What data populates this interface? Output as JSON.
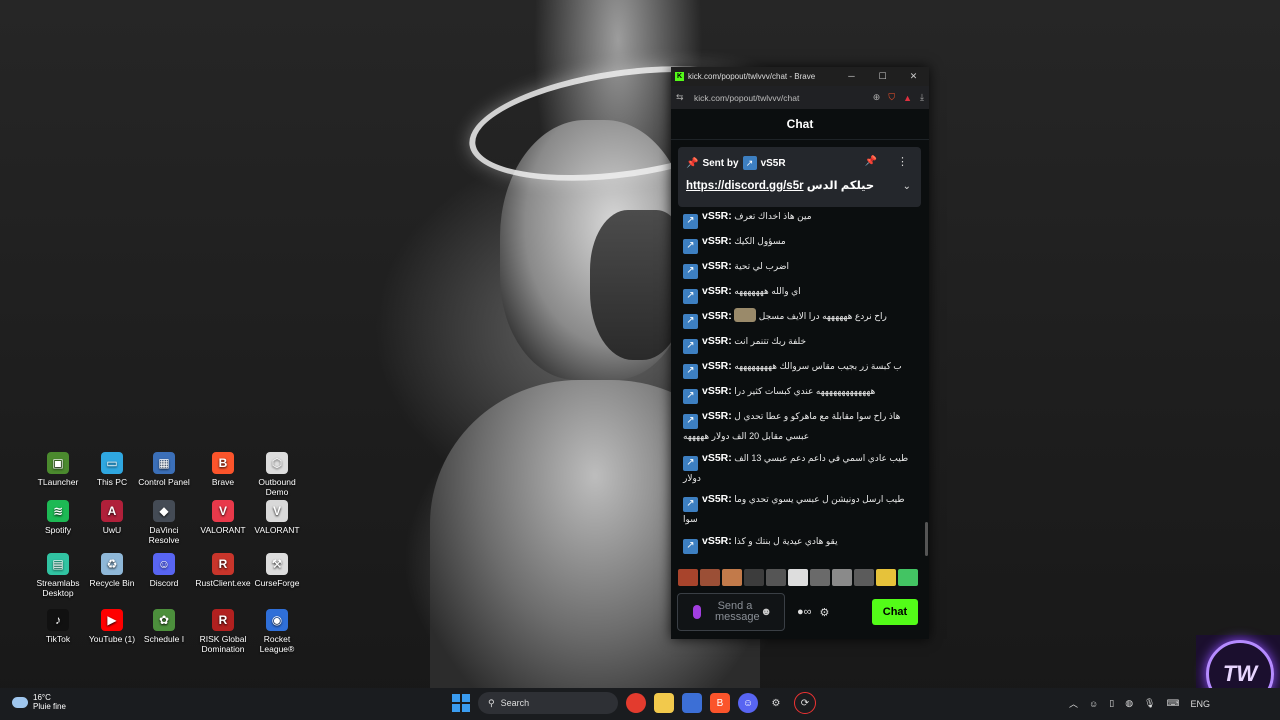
{
  "desktop_icons": [
    {
      "label": "TLauncher",
      "color": "#4b8a2e",
      "glyph": "▣"
    },
    {
      "label": "This PC",
      "color": "#2fa7e0",
      "glyph": "▭"
    },
    {
      "label": "Control Panel",
      "color": "#3b6fb8",
      "glyph": "▦"
    },
    {
      "label": "Brave",
      "color": "#fb542b",
      "glyph": "B"
    },
    {
      "label": "Outbound Demo",
      "color": "#dddddd",
      "glyph": "⬡"
    },
    {
      "label": "Spotify",
      "color": "#1db954",
      "glyph": "≋"
    },
    {
      "label": "UwU",
      "color": "#b0203a",
      "glyph": "A"
    },
    {
      "label": "DaVinci Resolve",
      "color": "#444b55",
      "glyph": "◆"
    },
    {
      "label": "VALORANT",
      "color": "#e8394a",
      "glyph": "V"
    },
    {
      "label": "VALORANT",
      "color": "#d9d9d9",
      "glyph": "V"
    },
    {
      "label": "Streamlabs Desktop",
      "color": "#31c3a2",
      "glyph": "▤"
    },
    {
      "label": "Recycle Bin",
      "color": "#8fb8d8",
      "glyph": "♻"
    },
    {
      "label": "Discord",
      "color": "#5865f2",
      "glyph": "☺"
    },
    {
      "label": "RustClient.exe",
      "color": "#c8352b",
      "glyph": "R"
    },
    {
      "label": "CurseForge",
      "color": "#dddddd",
      "glyph": "⚒"
    },
    {
      "label": "TikTok",
      "color": "#111111",
      "glyph": "♪"
    },
    {
      "label": "YouTube (1)",
      "color": "#ff0000",
      "glyph": "▶"
    },
    {
      "label": "Schedule I",
      "color": "#4c8f3c",
      "glyph": "✿"
    },
    {
      "label": "RISK Global Domination",
      "color": "#b1201f",
      "glyph": "R"
    },
    {
      "label": "Rocket League®",
      "color": "#2f6fd8",
      "glyph": "◉"
    }
  ],
  "browser": {
    "title": "kick.com/popout/twlvvv/chat - Brave",
    "url": "kick.com/popout/twlvvv/chat",
    "chat_title": "Chat"
  },
  "pinned": {
    "sent_by": "Sent by",
    "user": "vS5R",
    "link": "https://discord.gg/s5r",
    "text": "حيلكم الدس"
  },
  "messages": [
    {
      "user": "vS5R:",
      "text": "مين هاذ اخداك تعرف"
    },
    {
      "user": "vS5R:",
      "text": "مسؤول الكيك"
    },
    {
      "user": "vS5R:",
      "text": "اضرب لي تحية"
    },
    {
      "user": "vS5R:",
      "text": "اي والله هههههههه"
    },
    {
      "user": "vS5R:",
      "text": "راح نردع ههههههه درا الايف مسجل"
    },
    {
      "user": "vS5R:",
      "text": "خلفة ربك تتنمر انت"
    },
    {
      "user": "vS5R:",
      "text": "ب كبسة زر بجيب مقاس سروالك هههههههههه"
    },
    {
      "user": "vS5R:",
      "text": "هههههههههههههه عندي كبسات كثير درا"
    },
    {
      "user": "vS5R:",
      "text": "هاذ راح سوا مقابلة مع ماهركو و عطا تحدي ل عبسي مقابل 20 الف دولار هههههه"
    },
    {
      "user": "vS5R:",
      "text": "طيب عادي اسمي في داعم دعم عبسي 13 الف دولار"
    },
    {
      "user": "vS5R:",
      "text": "طيب ارسل دونيشن ل عبسي يسوي تحدي وما سوا"
    },
    {
      "user": "vS5R:",
      "text": "يقو هادي عيدية ل بنتك و كذا"
    }
  ],
  "input": {
    "placeholder": "Send a message",
    "chat_button": "Chat"
  },
  "logo": {
    "text": "TW"
  },
  "taskbar": {
    "temperature": "16°C",
    "weather": "Pluie fine",
    "search": "Search",
    "language": "ENG"
  }
}
